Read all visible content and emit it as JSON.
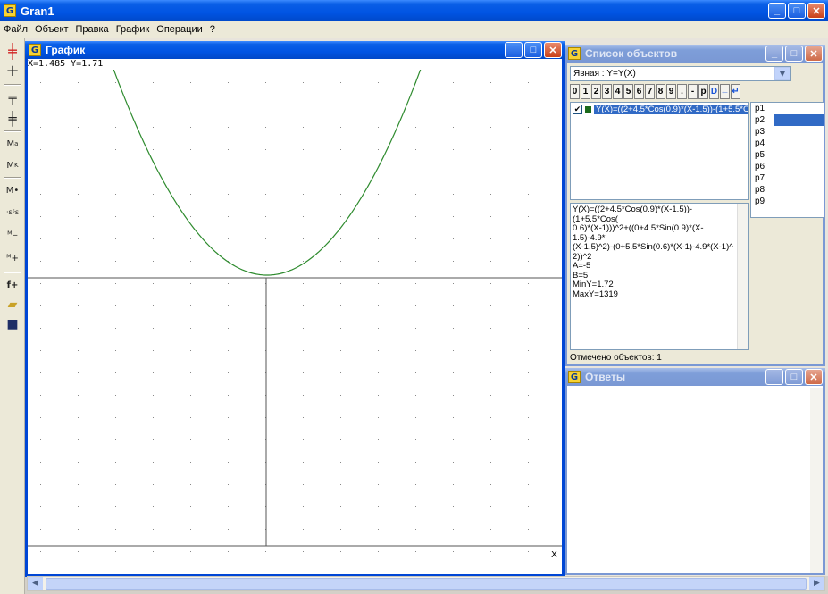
{
  "app": {
    "title": "Gran1"
  },
  "menu": [
    "Файл",
    "Объект",
    "Правка",
    "График",
    "Операции",
    "?"
  ],
  "toolbar": {
    "buttons": [
      "red-axes",
      "axes",
      "axes-move",
      "axes-alt",
      "Ma",
      "Mk",
      "M•",
      "points",
      "minus",
      "plus",
      "f+",
      "open",
      "save"
    ]
  },
  "graph_window": {
    "title": "График",
    "coords": "X=1.485 Y=1.71",
    "axis_x_label": "X"
  },
  "objects_window": {
    "title": "Список объектов",
    "mode": "Явная : Y=Y(X)",
    "keys": [
      "0",
      "1",
      "2",
      "3",
      "4",
      "5",
      "6",
      "7",
      "8",
      "9",
      ".",
      "-",
      "p",
      "D",
      "←",
      "↵"
    ],
    "object_formula": "Y(X)=((2+4.5*Cos(0.9)*(X-1.5))-(1+5.5*Cos(",
    "p_items": [
      "p1",
      "p2",
      "p3",
      "p4",
      "p5",
      "p6",
      "p7",
      "p8",
      "p9"
    ],
    "selected_p": 1,
    "info_lines": [
      "Y(X)=((2+4.5*Cos(0.9)*(X-1.5))-(1+5.5*Cos(",
      "0.6)*(X-1)))^2+((0+4.5*Sin(0.9)*(X-1.5)-4.9*",
      "(X-1.5)^2)-(0+5.5*Sin(0.6)*(X-1)-4.9*(X-1)^",
      "2))^2",
      "A=-5",
      "B=5",
      "MinY=1.72",
      "MaxY=1319"
    ],
    "status": "Отмечено объектов: 1"
  },
  "answers_window": {
    "title": "Ответы"
  },
  "colors": {
    "curve": "#2e8b2e",
    "title_active": "#0054e3",
    "title_inactive": "#7a98d4"
  }
}
